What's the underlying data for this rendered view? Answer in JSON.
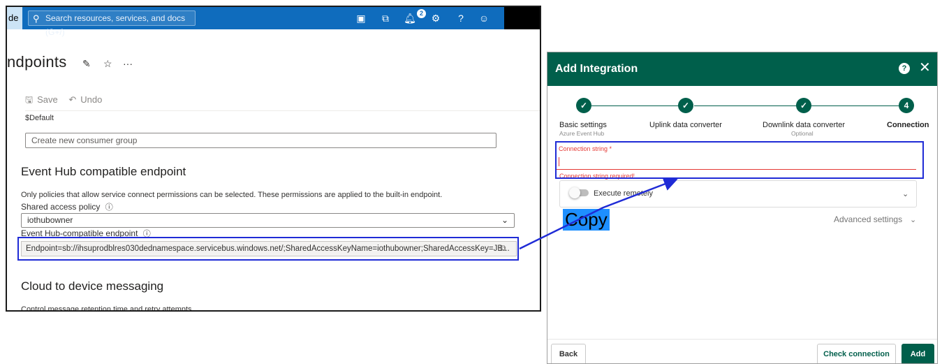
{
  "azure": {
    "brand": "de",
    "search_placeholder": "Search resources, services, and docs (G+/)",
    "notification_count": "2",
    "icons": [
      "cloud-shell-icon",
      "directory-filter-icon",
      "notification-bell-icon",
      "settings-gear-icon",
      "help-icon",
      "feedback-icon"
    ],
    "page_title": "ndpoints",
    "title_icons": [
      "pin-icon",
      "star-icon",
      "more-ellipsis-icon"
    ],
    "cmd": {
      "save": "Save",
      "undo": "Undo"
    },
    "default_label": "$Default",
    "consumer_placeholder": "Create new consumer group",
    "event_hub_section": "Event Hub compatible endpoint",
    "policy_description": "Only policies that allow service connect permissions can be selected. These permissions are applied to the built-in endpoint.",
    "policy_label": "Shared access policy",
    "policy_value": "iothubowner",
    "endpoint_label": "Event Hub-compatible endpoint",
    "endpoint_value": "Endpoint=sb://ihsuprodblres030dednamespace.servicebus.windows.net/;SharedAccessKeyName=iothubowner;SharedAccessKey=JB...",
    "c2d_section": "Cloud to device messaging",
    "c2d_description": "Control message retention time and retry attempts."
  },
  "dialog": {
    "title": "Add Integration",
    "steps": [
      {
        "label": "Basic settings",
        "sub": "Azure Event Hub",
        "mark": "✓",
        "state": "done"
      },
      {
        "label": "Uplink data converter",
        "sub": "",
        "mark": "✓",
        "state": "done"
      },
      {
        "label": "Downlink data converter",
        "sub": "Optional",
        "mark": "✓",
        "state": "done"
      },
      {
        "label": "Connection",
        "sub": "",
        "mark": "4",
        "state": "active"
      }
    ],
    "connection_label": "Connection string *",
    "connection_value": "",
    "connection_error": "Connection string required!",
    "execute_remotely_label": "Execute remotely",
    "execute_remotely_on": false,
    "advanced_settings": "Advanced settings",
    "back": "Back",
    "check_connection": "Check connection",
    "add": "Add"
  },
  "annotation": {
    "copy_label": "Copy",
    "highlight_color": "#1f2bd6",
    "copy_bg": "#1e8fff"
  },
  "colors": {
    "azure_blue": "#0f6cbd",
    "thingsboard_green": "#005f4b",
    "error_red": "#e53935"
  }
}
